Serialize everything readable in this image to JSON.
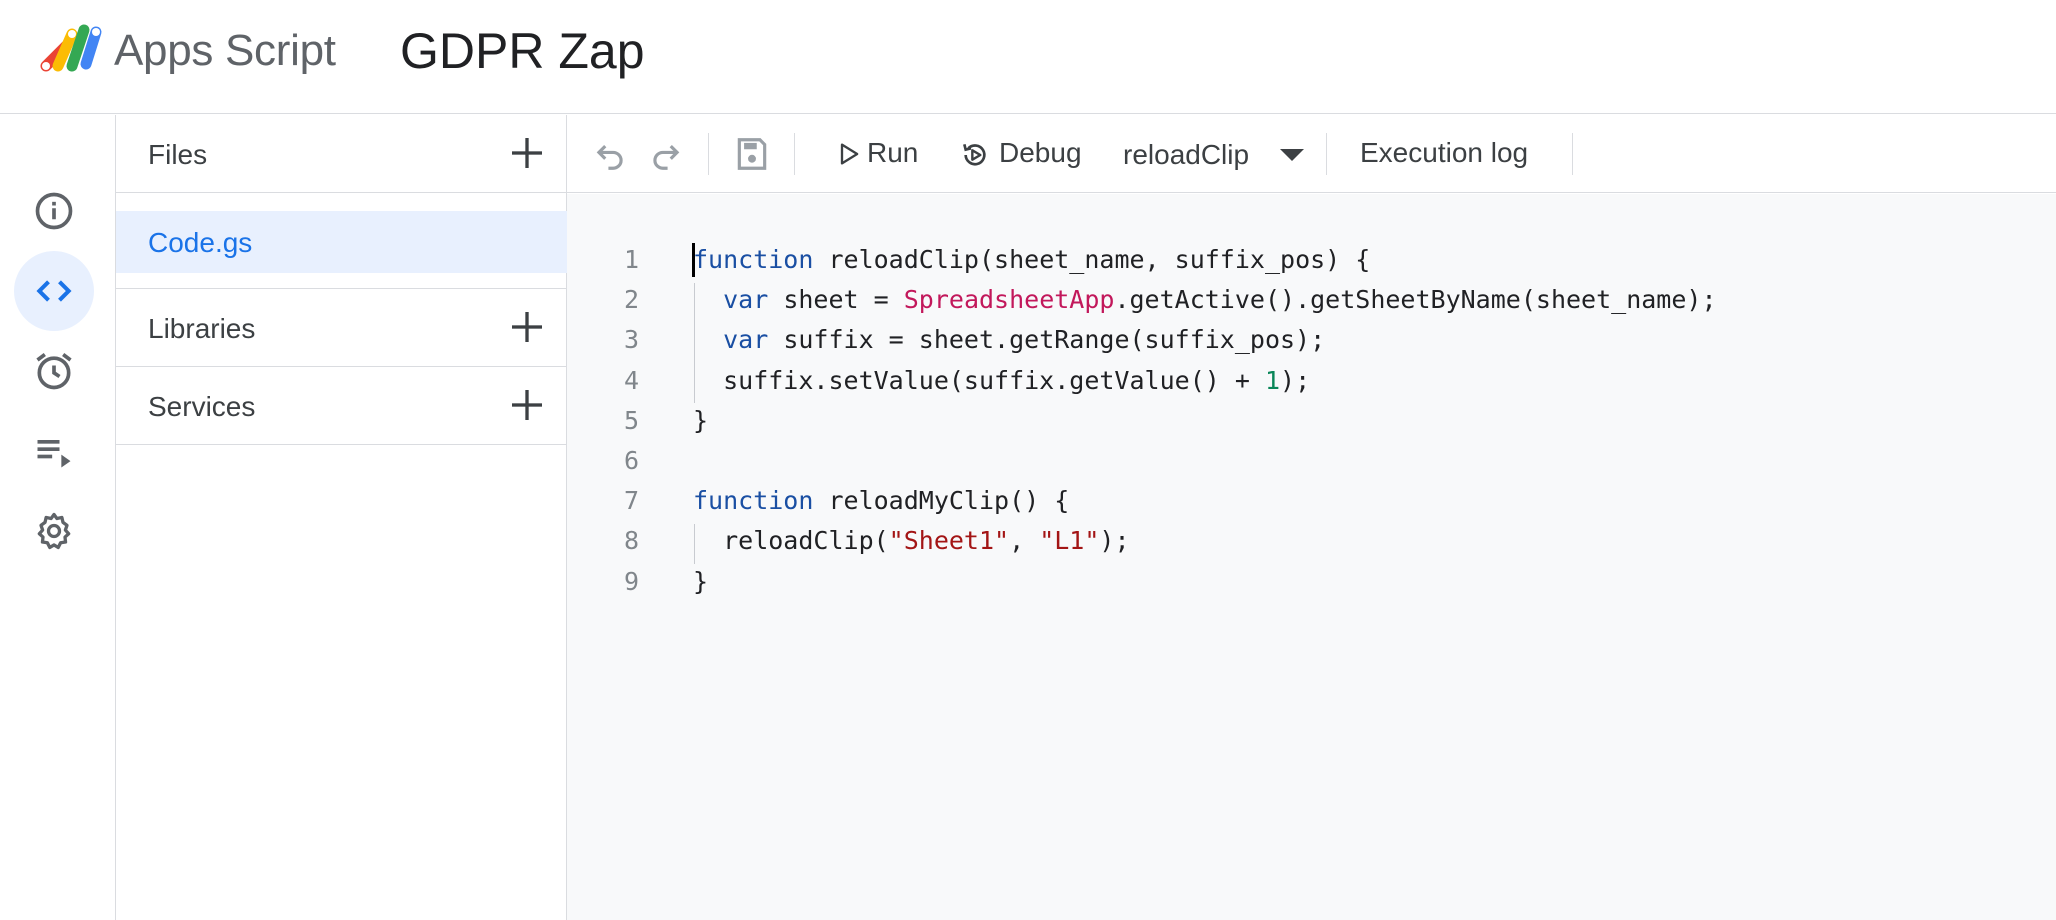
{
  "header": {
    "app_name": "Apps Script",
    "project_name": "GDPR Zap"
  },
  "rail": {
    "items": [
      {
        "icon": "info-icon"
      },
      {
        "icon": "code-icon",
        "active": true
      },
      {
        "icon": "alarm-clock-icon"
      },
      {
        "icon": "executions-icon"
      },
      {
        "icon": "gear-icon"
      }
    ]
  },
  "files_panel": {
    "files_label": "Files",
    "files": [
      "Code.gs"
    ],
    "libraries_label": "Libraries",
    "services_label": "Services"
  },
  "toolbar": {
    "run_label": "Run",
    "debug_label": "Debug",
    "function_selected": "reloadClip",
    "execution_log_label": "Execution log"
  },
  "editor": {
    "line_numbers": [
      "1",
      "2",
      "3",
      "4",
      "5",
      "6",
      "7",
      "8",
      "9"
    ],
    "lines": [
      {
        "tokens": [
          [
            "kw",
            "function"
          ],
          [
            "",
            " reloadClip(sheet_name, suffix_pos) {"
          ]
        ]
      },
      {
        "tokens": [
          [
            "",
            "  "
          ],
          [
            "kw",
            "var"
          ],
          [
            "",
            " sheet = "
          ],
          [
            "cls",
            "SpreadsheetApp"
          ],
          [
            "",
            ".getActive().getSheetByName(sheet_name);"
          ]
        ]
      },
      {
        "tokens": [
          [
            "",
            "  "
          ],
          [
            "kw",
            "var"
          ],
          [
            "",
            " suffix = sheet.getRange(suffix_pos);"
          ]
        ]
      },
      {
        "tokens": [
          [
            "",
            "  suffix.setValue(suffix.getValue() + "
          ],
          [
            "num",
            "1"
          ],
          [
            "",
            ");"
          ]
        ]
      },
      {
        "tokens": [
          [
            "",
            "}"
          ]
        ]
      },
      {
        "tokens": []
      },
      {
        "tokens": [
          [
            "kw",
            "function"
          ],
          [
            "",
            " reloadMyClip() {"
          ]
        ]
      },
      {
        "tokens": [
          [
            "",
            "  reloadClip("
          ],
          [
            "str",
            "\"Sheet1\""
          ],
          [
            "",
            ", "
          ],
          [
            "str",
            "\"L1\""
          ],
          [
            "",
            ");"
          ]
        ]
      },
      {
        "tokens": [
          [
            "",
            "}"
          ]
        ]
      }
    ]
  },
  "colors": {
    "accent": "#1a73e8",
    "active_bg": "#e8f0fe",
    "keyword": "#1a4fa3",
    "class": "#c2185b",
    "string": "#a31515",
    "number": "#098658"
  }
}
